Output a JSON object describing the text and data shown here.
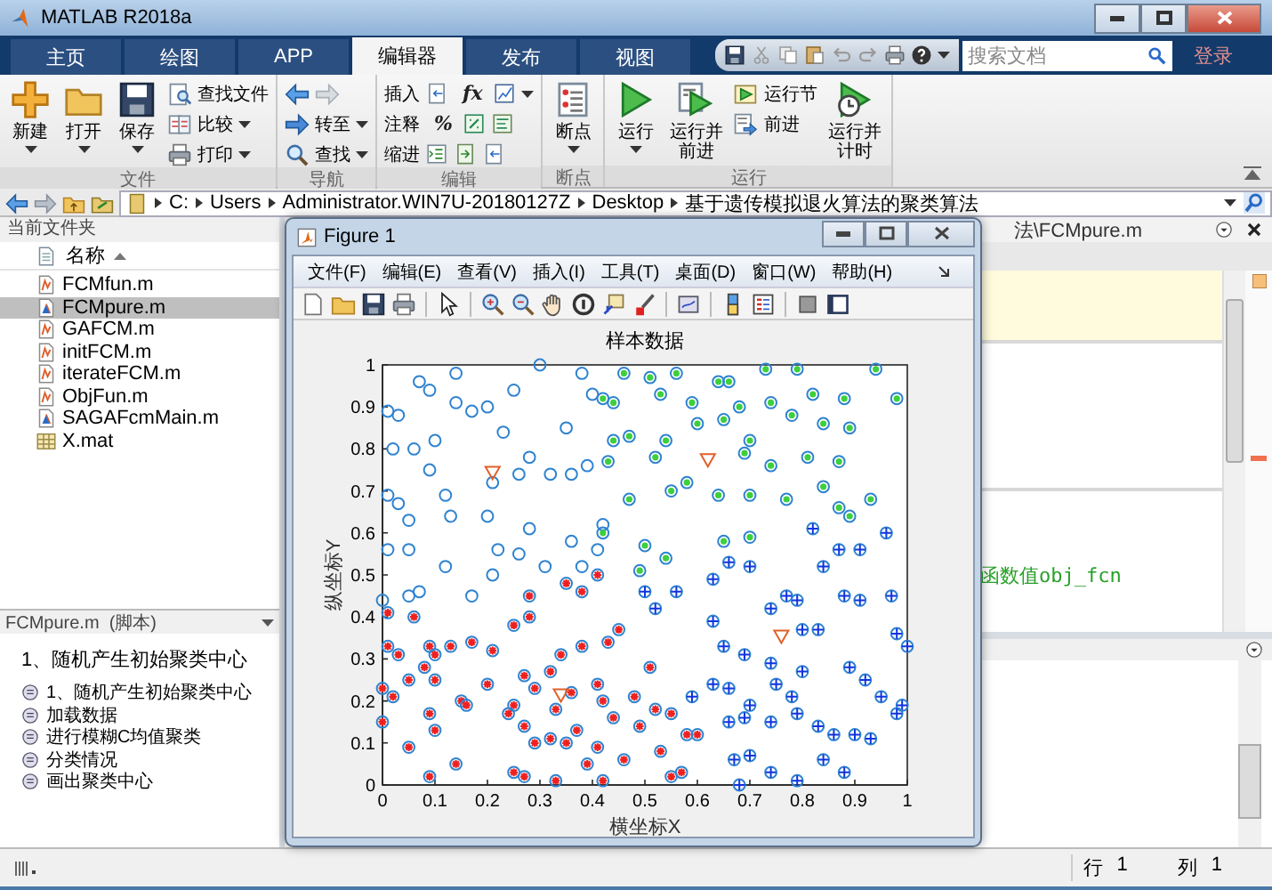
{
  "window": {
    "title": "MATLAB R2018a"
  },
  "tabs": [
    {
      "label": "主页",
      "selected": false
    },
    {
      "label": "绘图",
      "selected": false
    },
    {
      "label": "APP",
      "selected": false
    },
    {
      "label": "编辑器",
      "selected": true
    },
    {
      "label": "发布",
      "selected": false
    },
    {
      "label": "视图",
      "selected": false
    }
  ],
  "search": {
    "placeholder": "搜索文档"
  },
  "login": "登录",
  "ribbon": {
    "groups": [
      {
        "label": "文件",
        "items": [
          {
            "kind": "large",
            "label": "新建",
            "dropdown": true
          },
          {
            "kind": "large",
            "label": "打开",
            "dropdown": true
          },
          {
            "kind": "large",
            "label": "保存",
            "dropdown": true
          },
          {
            "kind": "small",
            "label": "查找文件",
            "dropdown": false
          },
          {
            "kind": "small",
            "label": "比较",
            "dropdown": true
          },
          {
            "kind": "small",
            "label": "打印",
            "dropdown": true
          }
        ]
      },
      {
        "label": "导航",
        "items": [
          {
            "kind": "arrows"
          },
          {
            "kind": "small",
            "label": "转至",
            "dropdown": true
          },
          {
            "kind": "small",
            "label": "查找",
            "dropdown": true
          }
        ]
      },
      {
        "label": "编辑",
        "items": [
          {
            "kind": "row",
            "label": "插入",
            "glyph": "fx",
            "dropdown": true
          },
          {
            "kind": "row",
            "label": "注释",
            "glyph": "%",
            "dropdown": false
          },
          {
            "kind": "row",
            "label": "缩进",
            "dropdown": false
          }
        ]
      },
      {
        "label": "断点",
        "items": [
          {
            "kind": "large",
            "label": "断点",
            "dropdown": true
          }
        ]
      },
      {
        "label": "运行",
        "items": [
          {
            "kind": "large",
            "label": "运行",
            "dropdown": true
          },
          {
            "kind": "large",
            "label": "运行并前进",
            "dropdown": false
          },
          {
            "kind": "small",
            "label": "运行节",
            "dropdown": false
          },
          {
            "kind": "small",
            "label": "前进",
            "dropdown": false
          },
          {
            "kind": "large",
            "label": "运行并计时",
            "dropdown": false
          }
        ]
      }
    ]
  },
  "address": {
    "path": [
      "C:",
      "Users",
      "Administrator.WIN7U-20180127Z",
      "Desktop",
      "基于遗传模拟退火算法的聚类算法"
    ]
  },
  "current_folder": {
    "title": "当前文件夹",
    "column": "名称",
    "files": [
      {
        "name": "FCMfun.m",
        "kind": "function",
        "selected": false
      },
      {
        "name": "FCMpure.m",
        "kind": "script",
        "selected": true
      },
      {
        "name": "GAFCM.m",
        "kind": "function",
        "selected": false
      },
      {
        "name": "initFCM.m",
        "kind": "function",
        "selected": false
      },
      {
        "name": "iterateFCM.m",
        "kind": "function",
        "selected": false
      },
      {
        "name": "ObjFun.m",
        "kind": "function",
        "selected": false
      },
      {
        "name": "SAGAFcmMain.m",
        "kind": "script",
        "selected": false
      },
      {
        "name": "X.mat",
        "kind": "data",
        "selected": false
      }
    ]
  },
  "details": {
    "title": "FCMpure.m  (脚本)",
    "heading": "1、随机产生初始聚类中心",
    "sections": [
      "1、随机产生初始聚类中心",
      "加载数据",
      "进行模糊C均值聚类",
      "分类情况",
      "画出聚类中心"
    ]
  },
  "editor": {
    "tab_title": "法\\FCMpure.m",
    "code_fragment": "函数值obj_fcn"
  },
  "status_bar": {
    "row_label": "行",
    "row": "1",
    "col_label": "列",
    "col": "1"
  },
  "figure": {
    "title": "Figure 1",
    "menu": [
      "文件(F)",
      "编辑(E)",
      "查看(V)",
      "插入(I)",
      "工具(T)",
      "桌面(D)",
      "窗口(W)",
      "帮助(H)"
    ],
    "chart_data": {
      "type": "scatter",
      "title": "样本数据",
      "xlabel": "横坐标X",
      "ylabel": "纵坐标Y",
      "xlim": [
        0,
        1
      ],
      "ylim": [
        0,
        1
      ],
      "xticks": [
        0,
        0.1,
        0.2,
        0.3,
        0.4,
        0.5,
        0.6,
        0.7,
        0.8,
        0.9,
        1
      ],
      "yticks": [
        0,
        0.1,
        0.2,
        0.3,
        0.4,
        0.5,
        0.6,
        0.7,
        0.8,
        0.9,
        1
      ],
      "series": [
        {
          "color": "#2f83d0",
          "x": [
            0.01,
            0.03,
            0.07,
            0.09,
            0.14,
            0.14,
            0.2,
            0.25,
            0.3,
            0.38,
            0.4,
            0.02,
            0.06,
            0.1,
            0.17,
            0.23,
            0.28,
            0.35,
            0.39,
            0.01,
            0.03,
            0.05,
            0.09,
            0.12,
            0.21,
            0.26,
            0.32,
            0.36,
            0.13,
            0.2,
            0.28,
            0.01,
            0.05,
            0.12,
            0.22,
            0.26,
            0.31,
            0.36,
            0.41,
            0.0,
            0.05,
            0.07,
            0.17,
            0.21,
            0.42,
            0.38
          ],
          "values": [
            0.89,
            0.88,
            0.96,
            0.94,
            0.98,
            0.91,
            0.9,
            0.94,
            1.0,
            0.98,
            0.93,
            0.8,
            0.8,
            0.82,
            0.89,
            0.84,
            0.78,
            0.85,
            0.76,
            0.69,
            0.67,
            0.63,
            0.75,
            0.69,
            0.72,
            0.74,
            0.74,
            0.74,
            0.64,
            0.64,
            0.61,
            0.56,
            0.56,
            0.52,
            0.56,
            0.55,
            0.52,
            0.58,
            0.56,
            0.44,
            0.45,
            0.46,
            0.45,
            0.5,
            0.62,
            0.52
          ]
        },
        {
          "color": "#3ecf3e",
          "x": [
            0.46,
            0.51,
            0.56,
            0.64,
            0.66,
            0.73,
            0.79,
            0.82,
            0.94,
            0.98,
            0.42,
            0.44,
            0.53,
            0.59,
            0.68,
            0.74,
            0.88,
            0.44,
            0.47,
            0.54,
            0.6,
            0.65,
            0.7,
            0.78,
            0.84,
            0.89,
            0.43,
            0.52,
            0.58,
            0.69,
            0.74,
            0.81,
            0.87,
            0.93,
            0.47,
            0.55,
            0.64,
            0.7,
            0.77,
            0.84,
            0.87,
            0.42,
            0.5,
            0.54,
            0.65,
            0.7,
            0.49,
            0.89
          ],
          "values": [
            0.98,
            0.97,
            0.98,
            0.96,
            0.96,
            0.99,
            0.99,
            0.93,
            0.99,
            0.92,
            0.92,
            0.91,
            0.93,
            0.91,
            0.9,
            0.91,
            0.92,
            0.82,
            0.83,
            0.82,
            0.86,
            0.87,
            0.82,
            0.88,
            0.86,
            0.85,
            0.77,
            0.78,
            0.72,
            0.79,
            0.76,
            0.78,
            0.77,
            0.68,
            0.68,
            0.7,
            0.69,
            0.69,
            0.68,
            0.71,
            0.66,
            0.6,
            0.57,
            0.54,
            0.58,
            0.59,
            0.51,
            0.64
          ]
        },
        {
          "color": "#ee2020",
          "x": [
            0.01,
            0.06,
            0.09,
            0.01,
            0.03,
            0.08,
            0.1,
            0.13,
            0.17,
            0.21,
            0.25,
            0.28,
            0.28,
            0.32,
            0.34,
            0.35,
            0.38,
            0.38,
            0.41,
            0.43,
            0.45,
            0.0,
            0.02,
            0.05,
            0.1,
            0.15,
            0.2,
            0.25,
            0.27,
            0.29,
            0.33,
            0.36,
            0.41,
            0.42,
            0.48,
            0.51,
            0.0,
            0.05,
            0.09,
            0.1,
            0.16,
            0.24,
            0.27,
            0.29,
            0.32,
            0.35,
            0.37,
            0.41,
            0.44,
            0.49,
            0.52,
            0.55,
            0.58,
            0.6,
            0.09,
            0.14,
            0.25,
            0.27,
            0.33,
            0.39,
            0.42,
            0.46,
            0.53,
            0.55,
            0.57
          ],
          "values": [
            0.41,
            0.4,
            0.33,
            0.33,
            0.31,
            0.28,
            0.31,
            0.33,
            0.34,
            0.32,
            0.38,
            0.45,
            0.4,
            0.27,
            0.31,
            0.48,
            0.46,
            0.33,
            0.5,
            0.34,
            0.37,
            0.23,
            0.21,
            0.25,
            0.25,
            0.2,
            0.24,
            0.19,
            0.26,
            0.23,
            0.18,
            0.22,
            0.24,
            0.2,
            0.21,
            0.28,
            0.15,
            0.09,
            0.17,
            0.13,
            0.19,
            0.17,
            0.14,
            0.1,
            0.11,
            0.1,
            0.13,
            0.09,
            0.16,
            0.14,
            0.18,
            0.17,
            0.12,
            0.12,
            0.02,
            0.05,
            0.03,
            0.02,
            0.01,
            0.05,
            0.01,
            0.06,
            0.08,
            0.02,
            0.03
          ]
        },
        {
          "color": "#1033e0",
          "x": [
            0.5,
            0.52,
            0.56,
            0.63,
            0.63,
            0.66,
            0.7,
            0.74,
            0.77,
            0.79,
            0.82,
            0.84,
            0.87,
            0.91,
            0.96,
            0.97,
            0.65,
            0.69,
            0.74,
            0.8,
            0.83,
            0.88,
            0.91,
            0.98,
            1.0,
            0.59,
            0.63,
            0.66,
            0.7,
            0.75,
            0.78,
            0.8,
            0.89,
            0.92,
            0.95,
            0.99,
            0.66,
            0.69,
            0.74,
            0.79,
            0.83,
            0.86,
            0.9,
            0.93,
            0.98,
            0.67,
            0.7,
            0.74,
            0.79,
            0.84,
            0.88,
            0.68
          ],
          "values": [
            0.46,
            0.42,
            0.46,
            0.39,
            0.49,
            0.53,
            0.52,
            0.42,
            0.45,
            0.44,
            0.61,
            0.52,
            0.56,
            0.56,
            0.6,
            0.45,
            0.33,
            0.31,
            0.29,
            0.37,
            0.37,
            0.45,
            0.44,
            0.36,
            0.33,
            0.21,
            0.24,
            0.23,
            0.19,
            0.24,
            0.21,
            0.27,
            0.28,
            0.25,
            0.21,
            0.19,
            0.15,
            0.16,
            0.15,
            0.17,
            0.14,
            0.12,
            0.12,
            0.11,
            0.17,
            0.06,
            0.07,
            0.03,
            0.01,
            0.06,
            0.03,
            0.0
          ]
        },
        {
          "color": "#e0602a",
          "x": [
            0.21,
            0.62,
            0.34,
            0.76
          ],
          "values": [
            0.745,
            0.775,
            0.215,
            0.355
          ]
        }
      ]
    }
  }
}
